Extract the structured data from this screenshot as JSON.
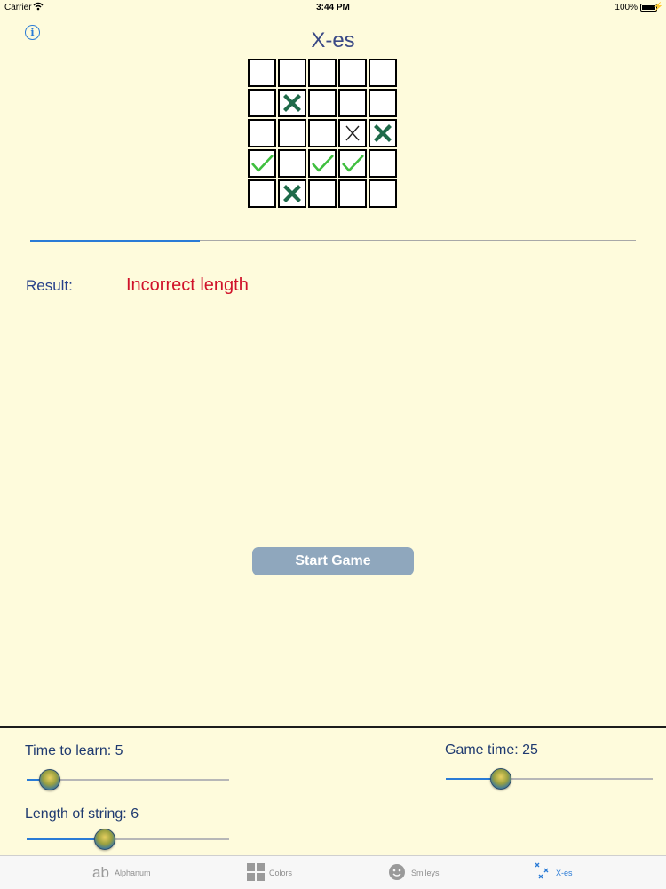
{
  "status_bar": {
    "carrier": "Carrier",
    "time": "3:44 PM",
    "battery": "100%"
  },
  "header": {
    "title": "X-es",
    "info_icon": "info-icon"
  },
  "grid": {
    "rows": 5,
    "cols": 5,
    "cells": [
      [
        "",
        "",
        "",
        "",
        ""
      ],
      [
        "",
        "x-bold",
        "",
        "",
        ""
      ],
      [
        "",
        "",
        "",
        "x-thin",
        "x-bold"
      ],
      [
        "check",
        "",
        "check",
        "check",
        ""
      ],
      [
        "",
        "x-bold",
        "",
        "",
        ""
      ]
    ]
  },
  "progress": 0.28,
  "result": {
    "label": "Result:",
    "value": "Incorrect length"
  },
  "start_button": "Start Game",
  "settings": {
    "time_to_learn": {
      "label": "Time to learn: 5",
      "value": 5,
      "fraction": 0.11
    },
    "game_time": {
      "label": "Game time: 25",
      "value": 25,
      "fraction": 0.26
    },
    "length_of_string": {
      "label": "Length of string: 6",
      "value": 6,
      "fraction": 0.38
    }
  },
  "tabs": [
    {
      "label": "Alphanum",
      "icon": "ab-icon",
      "active": false
    },
    {
      "label": "Colors",
      "icon": "grid-icon",
      "active": false
    },
    {
      "label": "Smileys",
      "icon": "smiley-icon",
      "active": false
    },
    {
      "label": "X-es",
      "icon": "xes-icon",
      "active": true
    }
  ],
  "colors": {
    "accent": "#2a7bd6",
    "error": "#d0122a",
    "x_bold": "#1f6b4a",
    "check": "#3fbf3f",
    "background": "#fefbdc"
  }
}
